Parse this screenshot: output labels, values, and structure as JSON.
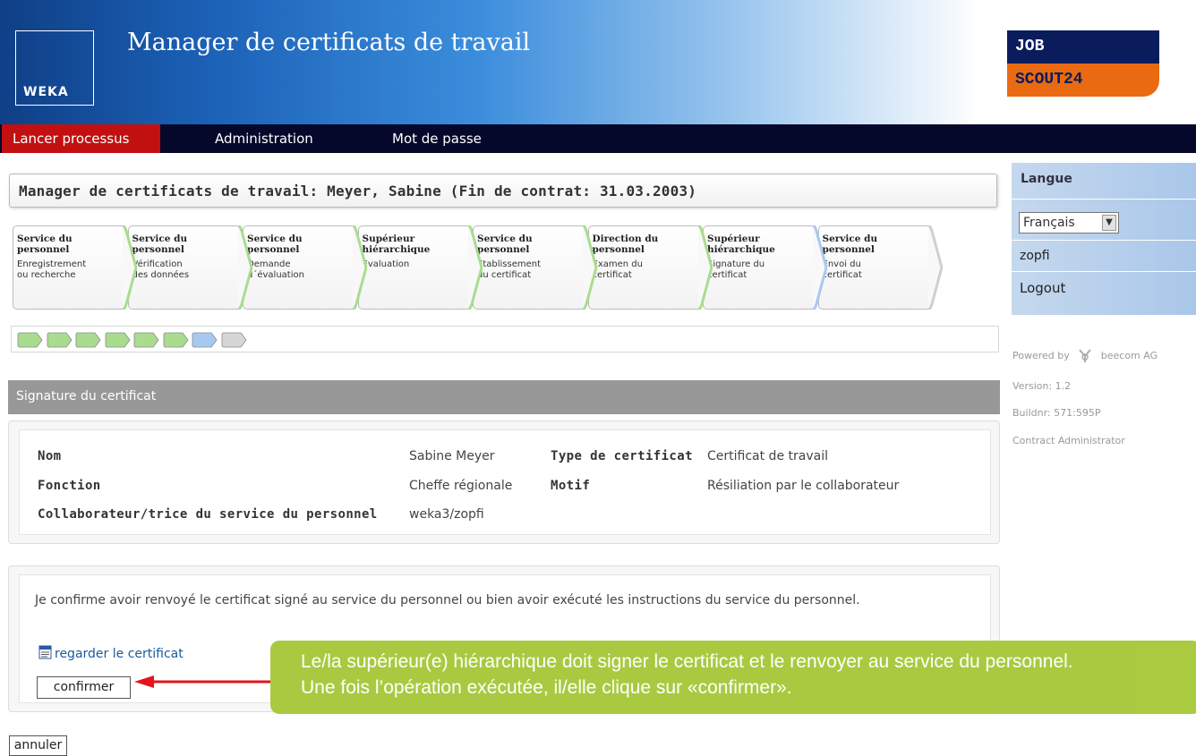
{
  "header": {
    "app_title": "Manager de certificats de travail",
    "weka_logo_text": "WEKA",
    "jobscout_top": "JOB",
    "jobscout_bottom": "SCOUT24"
  },
  "nav": {
    "start_process": "Lancer processus",
    "administration": "Administration",
    "password": "Mot de passe"
  },
  "sidebar": {
    "language_header": "Langue",
    "language_selected": "Français",
    "user": "zopfi",
    "logout": "Logout",
    "powered_by": "Powered by",
    "company": "beecom AG",
    "version": "Version: 1.2",
    "build": "Buildnr: 571:595P",
    "role": "Contract Administrator"
  },
  "title_bar": "Manager de certificats de travail: Meyer, Sabine (Fin de contrat: 31.03.2003)",
  "steps": [
    {
      "dept_line1": "Service du",
      "dept_line2": "personnel",
      "desc_line1": "Enregistrement",
      "desc_line2": "ou recherche",
      "status": "done"
    },
    {
      "dept_line1": "Service du",
      "dept_line2": "personnel",
      "desc_line1": "Vérification",
      "desc_line2": "des données",
      "status": "done"
    },
    {
      "dept_line1": "Service du",
      "dept_line2": "personnel",
      "desc_line1": "Demande",
      "desc_line2": "d´évaluation",
      "status": "done"
    },
    {
      "dept_line1": "Supérieur",
      "dept_line2": "hiérarchique",
      "desc_line1": "Evaluation",
      "desc_line2": "",
      "status": "done"
    },
    {
      "dept_line1": "Service du",
      "dept_line2": "personnel",
      "desc_line1": "Etablissement",
      "desc_line2": "du certificat",
      "status": "done"
    },
    {
      "dept_line1": "Direction du",
      "dept_line2": "personnel",
      "desc_line1": "Examen du",
      "desc_line2": "certificat",
      "status": "done"
    },
    {
      "dept_line1": "Supérieur",
      "dept_line2": "hiérarchique",
      "desc_line1": "Signature du",
      "desc_line2": "certificat",
      "status": "current"
    },
    {
      "dept_line1": "Service du",
      "dept_line2": "personnel",
      "desc_line1": "Envoi du",
      "desc_line2": "certificat",
      "status": "pending"
    }
  ],
  "progress_chips": [
    "done",
    "done",
    "done",
    "done",
    "done",
    "done",
    "current",
    "pending"
  ],
  "colors": {
    "done": "#a9dc8f",
    "current": "#a8c9ef",
    "pending": "#d6d6d6",
    "nav_active": "#c21010",
    "callout": "#a7c93a"
  },
  "section_title": "Signature du certificat",
  "info": {
    "name_label": "Nom",
    "name_value": "Sabine Meyer",
    "cert_type_label": "Type de certificat",
    "cert_type_value": "Certificat de travail",
    "function_label": "Fonction",
    "function_value": "Cheffe régionale",
    "reason_label": "Motif",
    "reason_value": "Résiliation par le collaborateur",
    "hr_staff_label": "Collaborateur/trice du service du personnel",
    "hr_staff_value": "weka3/zopfi"
  },
  "confirm": {
    "text": "Je confirme avoir renvoyé le certificat signé au service du personnel ou bien avoir exécuté les instructions du service du personnel.",
    "view_link": "regarder le certificat",
    "confirm_button": "confirmer",
    "cancel_button": "annuler"
  },
  "callout": {
    "line1": "Le/la supérieur(e) hiérarchique doit signer le certificat et le renvoyer au service du personnel.",
    "line2": "Une fois l’opération exécutée, il/elle clique sur «confirmer»."
  }
}
